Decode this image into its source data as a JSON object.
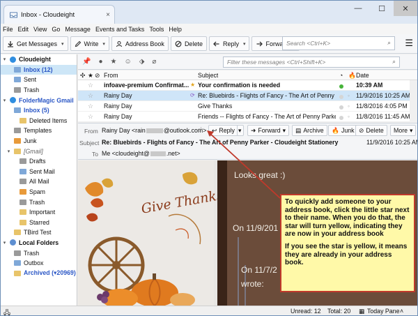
{
  "window": {
    "tab_title": "Inbox - Cloudeight",
    "tab_close": "×",
    "minimize": "—",
    "maximize": "☐",
    "close": "✕"
  },
  "menu": [
    "File",
    "Edit",
    "View",
    "Go",
    "Message",
    "Events and Tasks",
    "Tools",
    "Help"
  ],
  "toolbar": {
    "get_messages": "Get Messages",
    "write": "Write",
    "address_book": "Address Book",
    "delete": "Delete",
    "reply": "Reply",
    "forward": "Forward",
    "search_placeholder": "Search <Ctrl+K>"
  },
  "folders": [
    {
      "label": "Cloudeight",
      "kind": "account",
      "color": "#2f8ee0"
    },
    {
      "label": "Inbox (12)",
      "kind": "folder-blue-selected",
      "color": "#7fa8d8"
    },
    {
      "label": "Sent",
      "kind": "folder",
      "color": "#7fa8d8"
    },
    {
      "label": "Trash",
      "kind": "folder",
      "color": "#9a9a9a"
    },
    {
      "label": "FolderMagic Gmail",
      "kind": "account-blue",
      "color": "#2f8ee0"
    },
    {
      "label": "Inbox (5)",
      "kind": "folder-blue",
      "color": "#7fa8d8"
    },
    {
      "label": "Deleted Items",
      "kind": "subfolder",
      "color": "#e8c46a"
    },
    {
      "label": "Templates",
      "kind": "folder",
      "color": "#9a9a9a"
    },
    {
      "label": "Junk",
      "kind": "folder",
      "color": "#e89a3a"
    },
    {
      "label": "[Gmail]",
      "kind": "folder-gray",
      "color": "#e8c46a"
    },
    {
      "label": "Drafts",
      "kind": "subfolder",
      "color": "#9a9a9a"
    },
    {
      "label": "Sent Mail",
      "kind": "subfolder",
      "color": "#7fa8d8"
    },
    {
      "label": "All Mail",
      "kind": "subfolder",
      "color": "#9a9a9a"
    },
    {
      "label": "Spam",
      "kind": "subfolder",
      "color": "#e89a3a"
    },
    {
      "label": "Trash",
      "kind": "subfolder",
      "color": "#9a9a9a"
    },
    {
      "label": "Important",
      "kind": "subfolder",
      "color": "#e8c46a"
    },
    {
      "label": "Starred",
      "kind": "subfolder",
      "color": "#e8c46a"
    },
    {
      "label": "TBird Test",
      "kind": "folder",
      "color": "#e8c46a"
    },
    {
      "label": "Local Folders",
      "kind": "account",
      "color": "#5e8fd1"
    },
    {
      "label": "Trash",
      "kind": "folder",
      "color": "#9a9a9a"
    },
    {
      "label": "Outbox",
      "kind": "folder",
      "color": "#7fa8d8"
    },
    {
      "label": "Archived (▾20969)",
      "kind": "folder-blue",
      "color": "#e8c46a"
    }
  ],
  "filter": {
    "placeholder": "Filter these messages <Ctrl+Shift+K>"
  },
  "list": {
    "headers": {
      "from": "From",
      "subject": "Subject",
      "date": "Date"
    },
    "rows": [
      {
        "from": "infoave-premium Confirmat...",
        "subject": "Your confirmation is needed",
        "date": "10:39 AM",
        "unread": true,
        "selected": false,
        "thread": false,
        "status": "green"
      },
      {
        "from": "Rainy Day",
        "subject": "Re: Bluebirds - Flights of Fancy - The Art of Penny Par...",
        "date": "11/9/2016 10:25 AM",
        "unread": false,
        "selected": true,
        "thread": true,
        "status": "gray"
      },
      {
        "from": "Rainy Day",
        "subject": "Give Thanks",
        "date": "11/8/2016 4:05 PM",
        "unread": false,
        "selected": false,
        "thread": false,
        "status": "gray"
      },
      {
        "from": "Rainy Day",
        "subject": "Friends -- Flights of Fancy - The Art of Penny Parker",
        "date": "11/8/2016 11:45 AM",
        "unread": false,
        "selected": false,
        "thread": false,
        "status": "gray"
      }
    ]
  },
  "message": {
    "from_label": "From",
    "from_value": "Rainy Day <rain",
    "from_value_tail": "@outlook.com>",
    "subject_label": "Subject",
    "subject_value": "Re: Bluebirds - Flights of Fancy - The Art of Penny Parker - Cloudeight Stationery",
    "to_label": "To",
    "to_value": "Me <cloudeight@",
    "to_value_tail": ".net>",
    "date": "11/9/2016 10:25 AM",
    "buttons": {
      "reply": "Reply",
      "forward": "Forward",
      "archive": "Archive",
      "junk": "Junk",
      "delete": "Delete",
      "more": "More"
    }
  },
  "body": {
    "card_text": "Give Thanks!",
    "line1": "Looks great :)",
    "line2": "On 11/9/201",
    "line3": "On 11/7/2",
    "line4": "wrote:"
  },
  "callout": {
    "p1": "To quickly add someone to your address book, click the little star next to their name. When you do that, the star will turn yellow, indicating they are now in your address book",
    "p2": "If you see the star is yellow, it means they are already in your address book."
  },
  "status": {
    "unread": "Unread: 12",
    "total": "Total: 20",
    "today_pane": "Today Pane"
  }
}
